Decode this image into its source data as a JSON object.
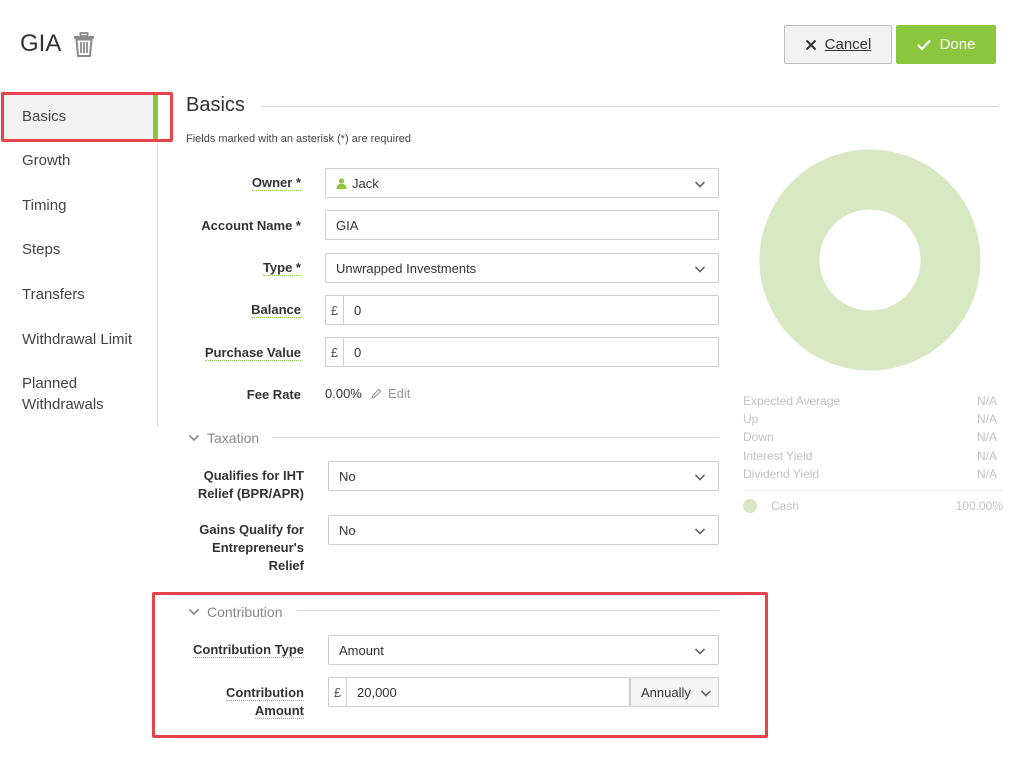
{
  "header": {
    "title": "GIA",
    "cancel_label": "Cancel",
    "done_label": "Done"
  },
  "sidebar": {
    "items": [
      {
        "label": "Basics"
      },
      {
        "label": "Growth"
      },
      {
        "label": "Timing"
      },
      {
        "label": "Steps"
      },
      {
        "label": "Transfers"
      },
      {
        "label": "Withdrawal Limit"
      },
      {
        "label": "Planned"
      },
      {
        "label": "Withdrawals"
      }
    ]
  },
  "main": {
    "section_title": "Basics",
    "required_note": "Fields marked with an asterisk (*) are required",
    "owner": {
      "label": "Owner *",
      "value": "Jack"
    },
    "account_name": {
      "label": "Account Name *",
      "value": "GIA"
    },
    "type": {
      "label": "Type *",
      "value": "Unwrapped Investments"
    },
    "balance": {
      "label": "Balance",
      "currency": "£",
      "value": "0"
    },
    "purchase_value": {
      "label": "Purchase Value",
      "currency": "£",
      "value": "0"
    },
    "fee_rate": {
      "label": "Fee Rate",
      "value": "0.00%",
      "edit_label": "Edit"
    },
    "taxation": {
      "heading": "Taxation",
      "iht": {
        "label_line1": "Qualifies for IHT",
        "label_line2": "Relief (BPR/APR)",
        "value": "No"
      },
      "entrepreneur": {
        "label_line1": "Gains Qualify for",
        "label_line2": "Entrepreneur's",
        "label_line3": "Relief",
        "value": "No"
      }
    },
    "contribution": {
      "heading": "Contribution",
      "type": {
        "label": "Contribution Type",
        "value": "Amount"
      },
      "amount": {
        "label_line1": "Contribution",
        "label_line2": "Amount",
        "currency": "£",
        "value": "20,000",
        "frequency": "Annually"
      }
    }
  },
  "stats": {
    "rows": [
      {
        "label": "Expected Average",
        "value": "N/A"
      },
      {
        "label": "Up",
        "value": "N/A"
      },
      {
        "label": "Down",
        "value": "N/A"
      },
      {
        "label": "Interest Yield",
        "value": "N/A"
      },
      {
        "label": "Dividend Yield",
        "value": "N/A"
      }
    ],
    "legend": {
      "label": "Cash",
      "value": "100.00%"
    }
  },
  "colors": {
    "accent": "#8cc63f",
    "highlight": "#e8424a",
    "donut": "#d7e8c3"
  }
}
